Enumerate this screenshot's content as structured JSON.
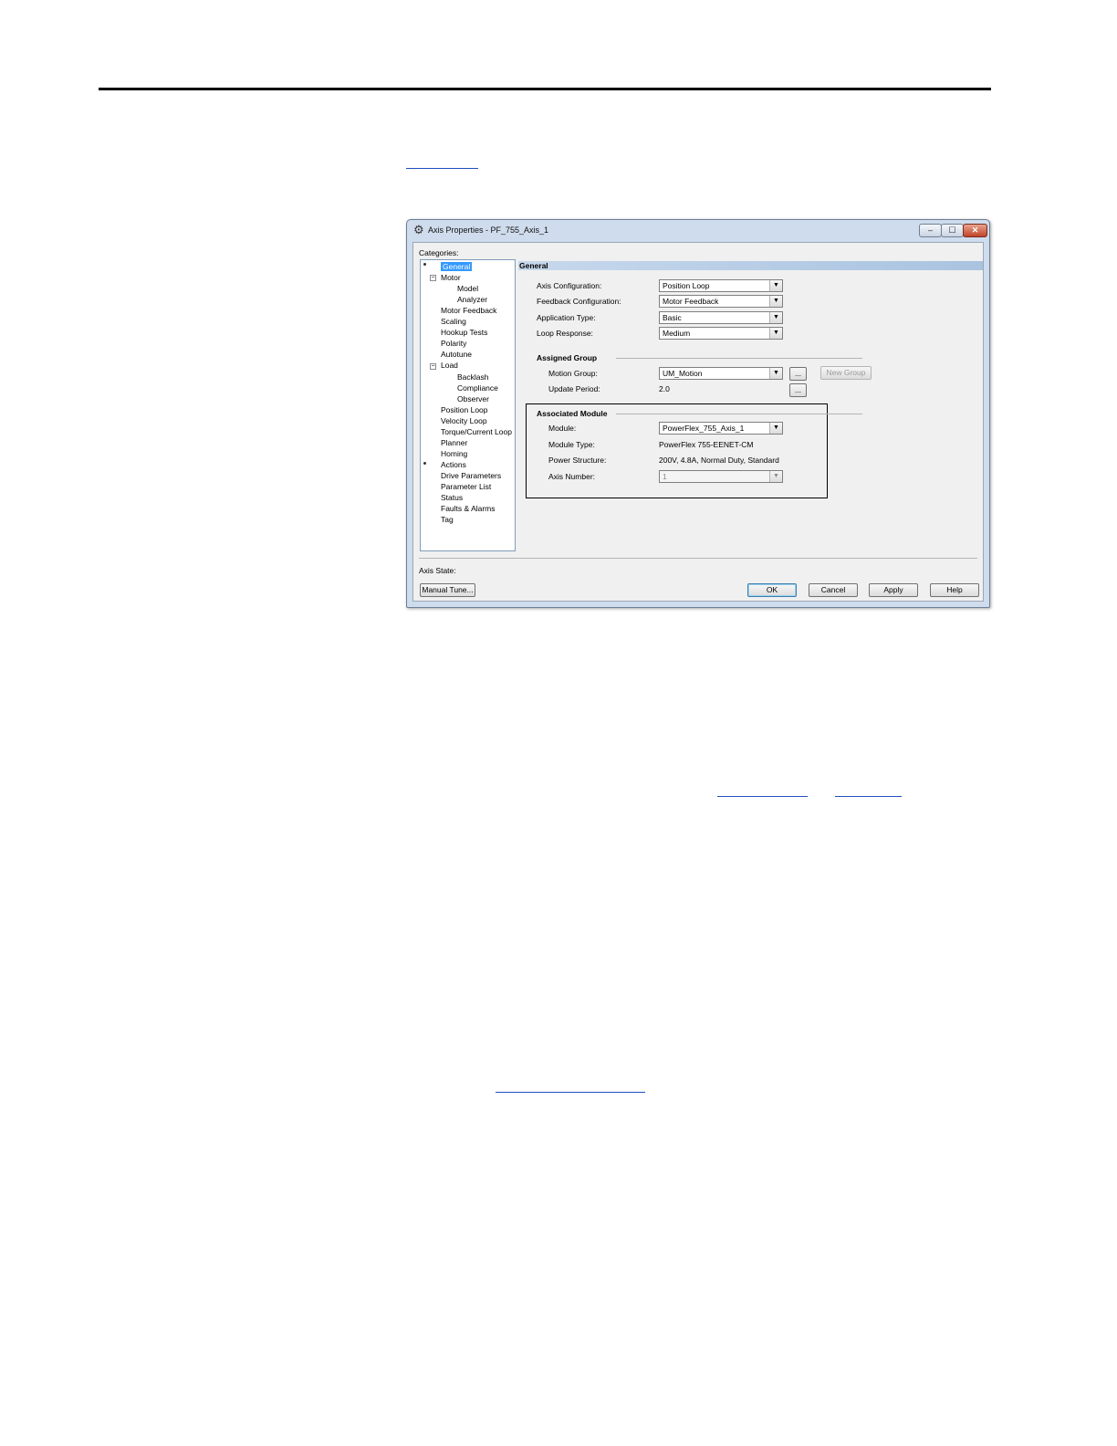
{
  "dialog": {
    "title": "Axis Properties - PF_755_Axis_1",
    "window_buttons": {
      "minimize": "–",
      "maximize": "☐",
      "close": "✕"
    },
    "categories_label": "Categories:",
    "tree": [
      {
        "label": "General",
        "selected": true
      },
      {
        "label": "Motor"
      },
      {
        "label": "Model"
      },
      {
        "label": "Analyzer"
      },
      {
        "label": "Motor Feedback"
      },
      {
        "label": "Scaling"
      },
      {
        "label": "Hookup Tests"
      },
      {
        "label": "Polarity"
      },
      {
        "label": "Autotune"
      },
      {
        "label": "Load"
      },
      {
        "label": "Backlash"
      },
      {
        "label": "Compliance"
      },
      {
        "label": "Observer"
      },
      {
        "label": "Position Loop"
      },
      {
        "label": "Velocity Loop"
      },
      {
        "label": "Torque/Current Loop"
      },
      {
        "label": "Planner"
      },
      {
        "label": "Homing"
      },
      {
        "label": "Actions"
      },
      {
        "label": "Drive Parameters"
      },
      {
        "label": "Parameter List"
      },
      {
        "label": "Status"
      },
      {
        "label": "Faults & Alarms"
      },
      {
        "label": "Tag"
      }
    ],
    "section_title": "General",
    "fields": {
      "axis_configuration": {
        "label": "Axis Configuration:",
        "value": "Position Loop"
      },
      "feedback_configuration": {
        "label": "Feedback Configuration:",
        "value": "Motor Feedback"
      },
      "application_type": {
        "label": "Application Type:",
        "value": "Basic"
      },
      "loop_response": {
        "label": "Loop Response:",
        "value": "Medium"
      }
    },
    "assigned_group": {
      "title": "Assigned Group",
      "motion_group": {
        "label": "Motion Group:",
        "value": "UM_Motion"
      },
      "update_period": {
        "label": "Update Period:",
        "value": "2.0"
      },
      "browse_label": "...",
      "new_group_label": "New Group"
    },
    "associated_module": {
      "title": "Associated Module",
      "module": {
        "label": "Module:",
        "value": "PowerFlex_755_Axis_1"
      },
      "module_type": {
        "label": "Module Type:",
        "value": "PowerFlex 755-EENET-CM"
      },
      "power_structure": {
        "label": "Power Structure:",
        "value": "200V, 4.8A, Normal Duty, Standard"
      },
      "axis_number": {
        "label": "Axis Number:",
        "value": "1"
      }
    },
    "axis_state_label": "Axis State:",
    "buttons": {
      "manual_tune": "Manual Tune...",
      "ok": "OK",
      "cancel": "Cancel",
      "apply": "Apply",
      "help": "Help"
    },
    "dropdown_arrow": "▼",
    "title_icon": "gear-icon"
  }
}
